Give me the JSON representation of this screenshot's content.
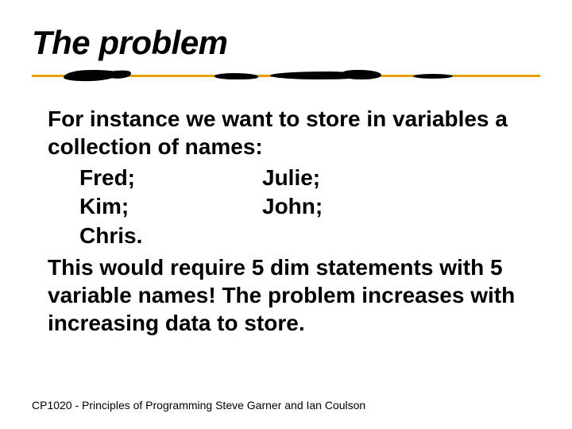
{
  "title": "The problem",
  "intro": "For instance we want to store in variables a collection of names:",
  "names": {
    "row1": {
      "left": "Fred;",
      "right": "Julie;"
    },
    "row2": {
      "left": "Kim;",
      "right": "John;"
    },
    "row3": {
      "left": "Chris."
    }
  },
  "outro": "This would require 5 dim statements with 5 variable names! The problem increases with increasing data to store.",
  "footer": "CP1020 - Principles of Programming  Steve Garner and Ian Coulson"
}
